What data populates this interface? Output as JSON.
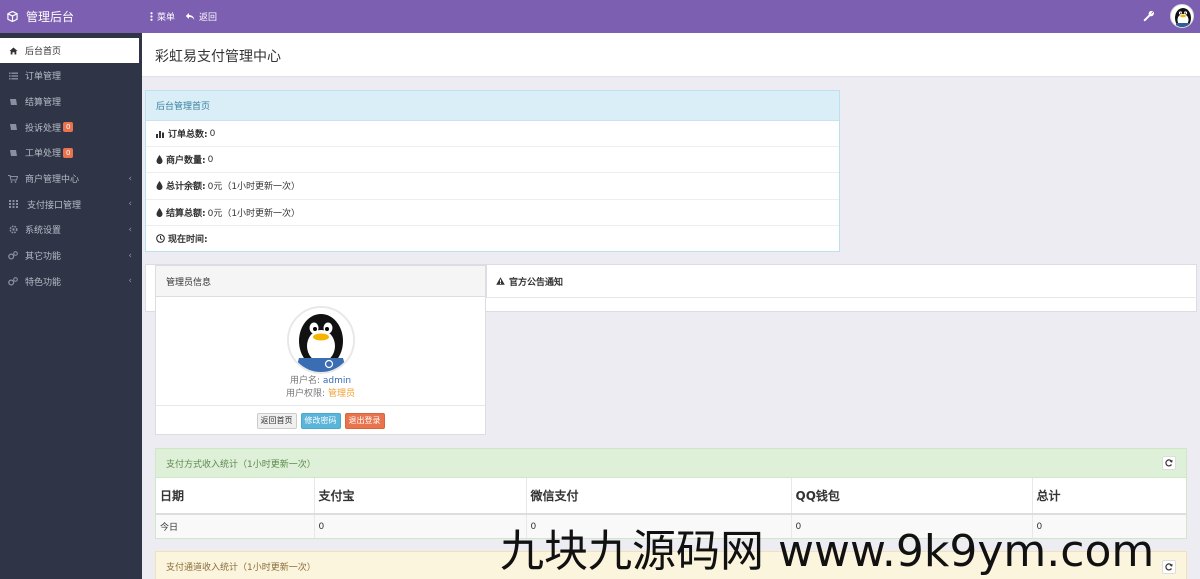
{
  "brand": {
    "title": "管理后台",
    "icon": "cube-icon"
  },
  "topbar": {
    "menu_label": "菜单",
    "back_label": "返回"
  },
  "sidebar": {
    "items": [
      {
        "label": "后台首页",
        "icon": "home-icon",
        "active": true
      },
      {
        "label": "订单管理",
        "icon": "list-icon"
      },
      {
        "label": "结算管理",
        "icon": "book-icon"
      },
      {
        "label": "投诉处理",
        "icon": "book-icon",
        "badge": "0"
      },
      {
        "label": "工单处理",
        "icon": "book-icon",
        "badge": "0"
      },
      {
        "label": "商户管理中心",
        "icon": "cart-icon",
        "chevron": "‹"
      },
      {
        "label": "支付接口管理",
        "icon": "grid-icon",
        "chevron": "‹"
      },
      {
        "label": "系统设置",
        "icon": "gear-icon",
        "chevron": "‹"
      },
      {
        "label": "其它功能",
        "icon": "gears-icon",
        "chevron": "‹"
      },
      {
        "label": "特色功能",
        "icon": "gears-icon",
        "chevron": "‹"
      }
    ]
  },
  "page": {
    "title": "彩虹易支付管理中心"
  },
  "summary": {
    "header": "后台管理首页",
    "rows": [
      {
        "label": "订单总数:",
        "value": "0",
        "icon": "bar-chart-icon"
      },
      {
        "label": "商户数量:",
        "value": "0",
        "icon": "drop-icon"
      },
      {
        "label": "总计余额:",
        "value": "0元（1小时更新一次）",
        "icon": "drop-icon"
      },
      {
        "label": "结算总额:",
        "value": "0元（1小时更新一次）",
        "icon": "drop-icon"
      },
      {
        "label": "现在时间:",
        "value": "",
        "icon": "clock-icon"
      }
    ]
  },
  "admin": {
    "header": "管理员信息",
    "username_label": "用户名:",
    "username": "admin",
    "role_label": "用户权限:",
    "role": "管理员",
    "buttons": {
      "home": "返回首页",
      "password": "修改密码",
      "logout": "退出登录"
    }
  },
  "notice": {
    "header": "官方公告通知"
  },
  "pay_stats": {
    "header": "支付方式收入统计（1小时更新一次）",
    "columns": [
      "日期",
      "支付宝",
      "微信支付",
      "QQ钱包",
      "总计"
    ],
    "rows": [
      [
        "今日",
        "0",
        "0",
        "0",
        "0"
      ]
    ]
  },
  "channel_stats": {
    "header": "支付通道收入统计（1小时更新一次）"
  },
  "watermark": "九块九源码网 www.9k9ym.com"
}
